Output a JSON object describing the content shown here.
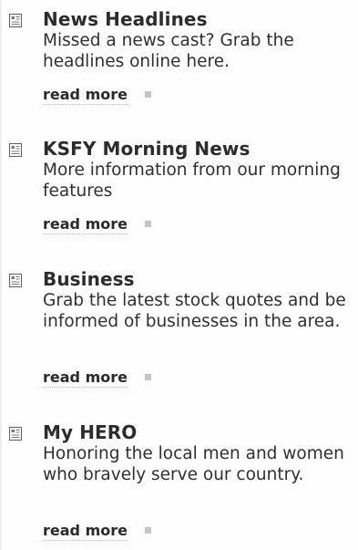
{
  "items": [
    {
      "title": "News Headlines",
      "description": "Missed a news cast? Grab the headlines online here.",
      "link_label": "read more",
      "icon": "document-icon"
    },
    {
      "title": "KSFY Morning News",
      "description": "More information from our morning features",
      "link_label": "read more",
      "icon": "document-icon"
    },
    {
      "title": "Business",
      "description": "Grab the latest stock quotes and be informed of businesses in the area.",
      "link_label": "read more",
      "icon": "document-icon"
    },
    {
      "title": "My HERO",
      "description": "Honoring the local men and women who bravely serve our country.",
      "link_label": "read more",
      "icon": "document-icon"
    }
  ]
}
